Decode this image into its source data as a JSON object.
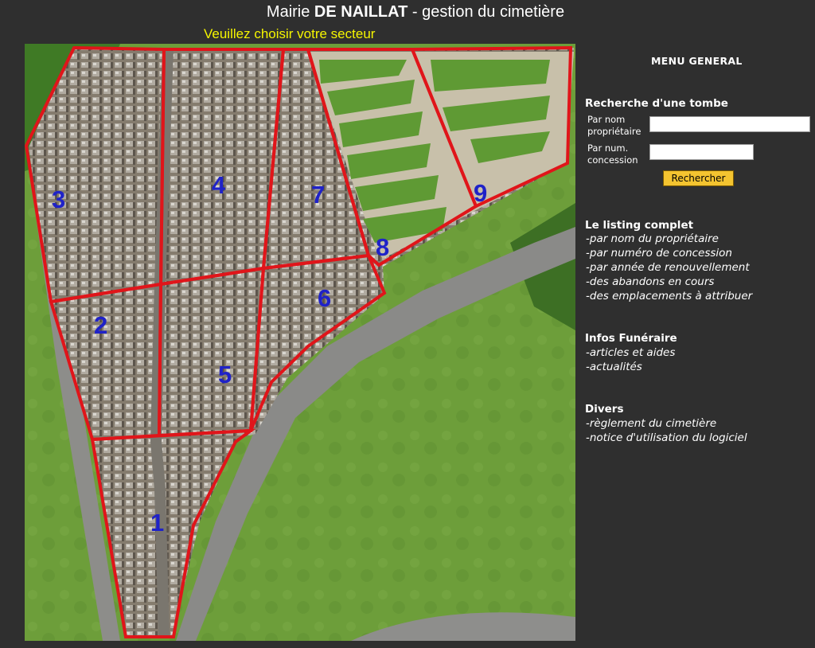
{
  "header": {
    "title_prefix": "Mairie ",
    "title_commune": "DE NAILLAT",
    "title_suffix": " - gestion du cimetière",
    "subtitle": "Veuillez choisir votre secteur"
  },
  "map": {
    "sectors": [
      {
        "id": 1,
        "label": "1"
      },
      {
        "id": 2,
        "label": "2"
      },
      {
        "id": 3,
        "label": "3"
      },
      {
        "id": 4,
        "label": "4"
      },
      {
        "id": 5,
        "label": "5"
      },
      {
        "id": 6,
        "label": "6"
      },
      {
        "id": 7,
        "label": "7"
      },
      {
        "id": 8,
        "label": "8"
      },
      {
        "id": 9,
        "label": "9"
      }
    ],
    "colors": {
      "sector_border": "#e0151a",
      "sector_label": "#1f22c8",
      "grass": "#6ea03c",
      "road": "#8c8c8c"
    }
  },
  "sidebar": {
    "menu_title": "MENU GENERAL",
    "search": {
      "heading": "Recherche d'une tombe",
      "by_name_label_1": "Par nom",
      "by_name_label_2": "propriétaire",
      "by_concession_label_1": "Par num.",
      "by_concession_label_2": "concession",
      "name_value": "",
      "concession_value": "",
      "button_label": "Rechercher"
    },
    "listing": {
      "heading": "Le listing complet",
      "links": [
        "-par nom du propriétaire",
        "-par numéro de concession",
        "-par année de renouvellement",
        "-des abandons en cours",
        "-des emplacements à attribuer"
      ]
    },
    "infos": {
      "heading": "Infos Funéraire",
      "links": [
        "-articles et aides",
        "-actualités"
      ]
    },
    "divers": {
      "heading": "Divers",
      "links": [
        "-règlement du cimetière",
        "-notice d'utilisation du logiciel"
      ]
    }
  }
}
